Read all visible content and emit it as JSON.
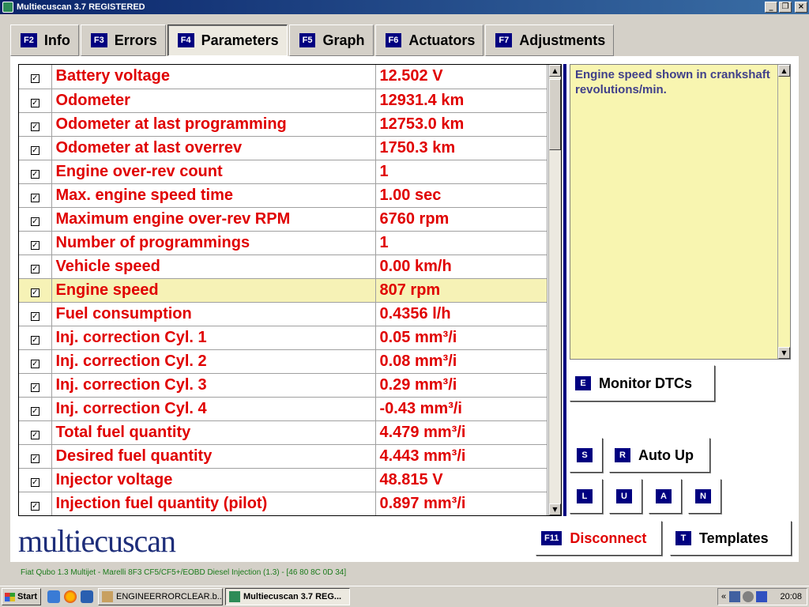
{
  "window": {
    "title": "Multiecuscan 3.7 REGISTERED",
    "minimize_label": "_",
    "restore_label": "❐",
    "close_label": "×"
  },
  "tabs": [
    {
      "key": "F2",
      "label": "Info"
    },
    {
      "key": "F3",
      "label": "Errors"
    },
    {
      "key": "F4",
      "label": "Parameters",
      "active": true
    },
    {
      "key": "F5",
      "label": "Graph"
    },
    {
      "key": "F6",
      "label": "Actuators"
    },
    {
      "key": "F7",
      "label": "Adjustments"
    }
  ],
  "check_glyph": "✓",
  "scroll_up": "▲",
  "scroll_down": "▼",
  "parameters": [
    {
      "name": "Battery voltage",
      "value": "12.502 V",
      "checked": true
    },
    {
      "name": "Odometer",
      "value": "12931.4 km",
      "checked": true
    },
    {
      "name": "Odometer at last programming",
      "value": "12753.0 km",
      "checked": true
    },
    {
      "name": "Odometer at last overrev",
      "value": "1750.3 km",
      "checked": true
    },
    {
      "name": "Engine over-rev count",
      "value": "1",
      "checked": true
    },
    {
      "name": "Max. engine speed time",
      "value": "1.00 sec",
      "checked": true
    },
    {
      "name": "Maximum engine over-rev RPM",
      "value": "6760 rpm",
      "checked": true
    },
    {
      "name": "Number of programmings",
      "value": "1",
      "checked": true
    },
    {
      "name": "Vehicle speed",
      "value": "0.00 km/h",
      "checked": true
    },
    {
      "name": "Engine speed",
      "value": "807 rpm",
      "checked": true,
      "selected": true
    },
    {
      "name": "Fuel consumption",
      "value": "0.4356 l/h",
      "checked": true
    },
    {
      "name": "Inj. correction Cyl. 1",
      "value": "0.05 mm³/i",
      "checked": true
    },
    {
      "name": "Inj. correction Cyl. 2",
      "value": "0.08 mm³/i",
      "checked": true
    },
    {
      "name": "Inj. correction Cyl. 3",
      "value": "0.29 mm³/i",
      "checked": true
    },
    {
      "name": "Inj. correction Cyl. 4",
      "value": "-0.43 mm³/i",
      "checked": true
    },
    {
      "name": "Total fuel quantity",
      "value": "4.479 mm³/i",
      "checked": true
    },
    {
      "name": "Desired fuel quantity",
      "value": "4.443 mm³/i",
      "checked": true
    },
    {
      "name": "Injector voltage",
      "value": "48.815 V",
      "checked": true
    },
    {
      "name": "Injection fuel quantity (pilot)",
      "value": "0.897 mm³/i",
      "checked": true
    }
  ],
  "description": "Engine speed shown in crankshaft revolutions/min.",
  "buttons": {
    "monitor_dtcs": {
      "key": "E",
      "label": "Monitor DTCs"
    },
    "s": {
      "key": "S"
    },
    "auto_up": {
      "key": "R",
      "label": "Auto Up"
    },
    "l": {
      "key": "L"
    },
    "u": {
      "key": "U"
    },
    "a": {
      "key": "A"
    },
    "n": {
      "key": "N"
    },
    "disconnect": {
      "key": "F11",
      "label": "Disconnect"
    },
    "templates": {
      "key": "T",
      "label": "Templates"
    }
  },
  "logo": "multiecuscan",
  "status_line": "Fiat Qubo 1.3 Multijet - Marelli 8F3 CF5/CF5+/EOBD Diesel Injection (1.3) - [46 80 8C 0D 34]",
  "taskbar": {
    "start": "Start",
    "items": [
      {
        "label": "ENGINEERRORCLEAR.b..."
      },
      {
        "label": "Multiecuscan 3.7 REG...",
        "active": true
      }
    ],
    "tray_chevron": "«",
    "clock": "20:08"
  },
  "colors": {
    "param_text": "#e00000",
    "selected_row": "#f6f2b6",
    "description_bg": "#f8f5b0",
    "fkey_badge": "#000080",
    "disconnect_text": "#e00000",
    "status_text": "#1a7a1a"
  }
}
